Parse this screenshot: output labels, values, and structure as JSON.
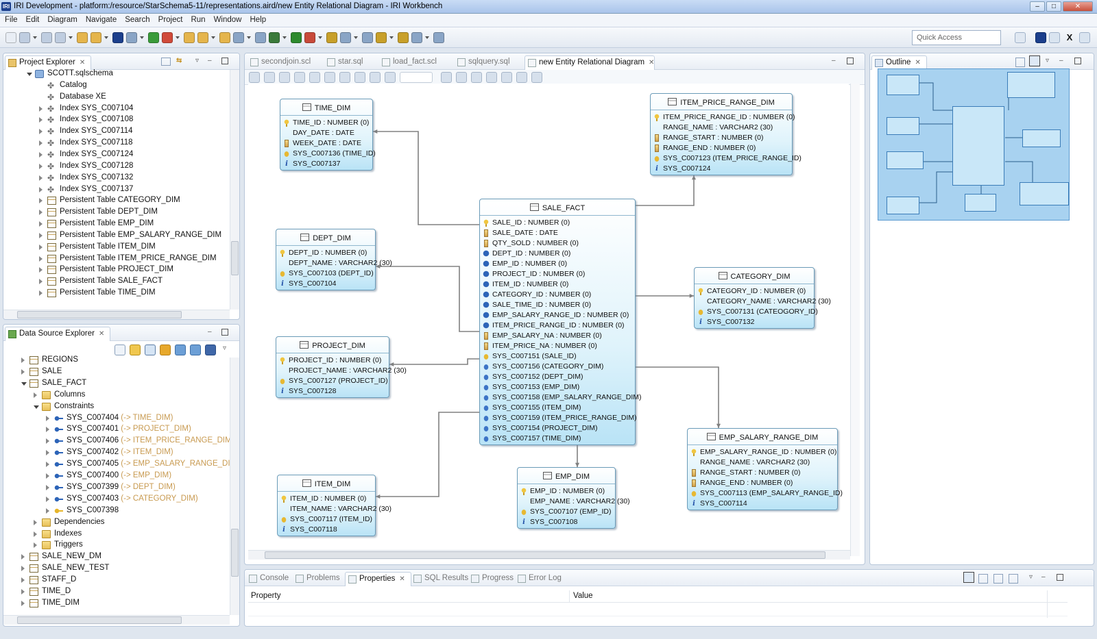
{
  "window": {
    "title": "IRI Development - platform:/resource/StarSchema5-11/representations.aird/new Entity Relational Diagram - IRI Workbench",
    "logo": "IRI",
    "controls": [
      "minimize-icon",
      "restore-icon",
      "close-icon"
    ]
  },
  "menu": [
    "File",
    "Edit",
    "Diagram",
    "Navigate",
    "Search",
    "Project",
    "Run",
    "Window",
    "Help"
  ],
  "quick_access": {
    "placeholder": "Quick Access"
  },
  "project_explorer": {
    "tab": "Project Explorer",
    "items": [
      {
        "label": "SCOTT.sqlschema",
        "level": 0,
        "state": "expanded",
        "icon": "schema-icon"
      },
      {
        "label": "Catalog",
        "level": 1,
        "state": "none",
        "icon": "catalog-icon"
      },
      {
        "label": "Database XE",
        "level": 1,
        "state": "none",
        "icon": "database-icon"
      },
      {
        "label": "Index SYS_C007104",
        "level": 1,
        "state": "collapsed",
        "icon": "index-icon"
      },
      {
        "label": "Index SYS_C007108",
        "level": 1,
        "state": "collapsed",
        "icon": "index-icon"
      },
      {
        "label": "Index SYS_C007114",
        "level": 1,
        "state": "collapsed",
        "icon": "index-icon"
      },
      {
        "label": "Index SYS_C007118",
        "level": 1,
        "state": "collapsed",
        "icon": "index-icon"
      },
      {
        "label": "Index SYS_C007124",
        "level": 1,
        "state": "collapsed",
        "icon": "index-icon"
      },
      {
        "label": "Index SYS_C007128",
        "level": 1,
        "state": "collapsed",
        "icon": "index-icon"
      },
      {
        "label": "Index SYS_C007132",
        "level": 1,
        "state": "collapsed",
        "icon": "index-icon"
      },
      {
        "label": "Index SYS_C007137",
        "level": 1,
        "state": "collapsed",
        "icon": "index-icon"
      },
      {
        "label": "Persistent Table CATEGORY_DIM",
        "level": 1,
        "state": "collapsed",
        "icon": "table-icon"
      },
      {
        "label": "Persistent Table DEPT_DIM",
        "level": 1,
        "state": "collapsed",
        "icon": "table-icon"
      },
      {
        "label": "Persistent Table EMP_DIM",
        "level": 1,
        "state": "collapsed",
        "icon": "table-icon"
      },
      {
        "label": "Persistent Table EMP_SALARY_RANGE_DIM",
        "level": 1,
        "state": "collapsed",
        "icon": "table-icon"
      },
      {
        "label": "Persistent Table ITEM_DIM",
        "level": 1,
        "state": "collapsed",
        "icon": "table-icon"
      },
      {
        "label": "Persistent Table ITEM_PRICE_RANGE_DIM",
        "level": 1,
        "state": "collapsed",
        "icon": "table-icon"
      },
      {
        "label": "Persistent Table PROJECT_DIM",
        "level": 1,
        "state": "collapsed",
        "icon": "table-icon"
      },
      {
        "label": "Persistent Table SALE_FACT",
        "level": 1,
        "state": "collapsed",
        "icon": "table-icon"
      },
      {
        "label": "Persistent Table TIME_DIM",
        "level": 1,
        "state": "collapsed",
        "icon": "table-icon"
      }
    ]
  },
  "data_source_explorer": {
    "tab": "Data Source Explorer",
    "items": [
      {
        "label": "REGIONS",
        "ref": "",
        "level": 0,
        "state": "collapsed",
        "icon": "table-icon"
      },
      {
        "label": "SALE",
        "ref": "",
        "level": 0,
        "state": "collapsed",
        "icon": "table-icon"
      },
      {
        "label": "SALE_FACT",
        "ref": "",
        "level": 0,
        "state": "expanded",
        "icon": "table-icon"
      },
      {
        "label": "Columns",
        "ref": "",
        "level": 1,
        "state": "collapsed",
        "icon": "folder-icon"
      },
      {
        "label": "Constraints",
        "ref": "",
        "level": 1,
        "state": "expanded",
        "icon": "folder-icon"
      },
      {
        "label": "SYS_C007404",
        "ref": "(-> TIME_DIM)",
        "level": 2,
        "state": "collapsed",
        "icon": "foreign-key-icon"
      },
      {
        "label": "SYS_C007401",
        "ref": "(-> PROJECT_DIM)",
        "level": 2,
        "state": "collapsed",
        "icon": "foreign-key-icon"
      },
      {
        "label": "SYS_C007406",
        "ref": "(-> ITEM_PRICE_RANGE_DIM)",
        "level": 2,
        "state": "collapsed",
        "icon": "foreign-key-icon"
      },
      {
        "label": "SYS_C007402",
        "ref": "(-> ITEM_DIM)",
        "level": 2,
        "state": "collapsed",
        "icon": "foreign-key-icon"
      },
      {
        "label": "SYS_C007405",
        "ref": "(-> EMP_SALARY_RANGE_DIM)",
        "level": 2,
        "state": "collapsed",
        "icon": "foreign-key-icon"
      },
      {
        "label": "SYS_C007400",
        "ref": "(-> EMP_DIM)",
        "level": 2,
        "state": "collapsed",
        "icon": "foreign-key-icon"
      },
      {
        "label": "SYS_C007399",
        "ref": "(-> DEPT_DIM)",
        "level": 2,
        "state": "collapsed",
        "icon": "foreign-key-icon"
      },
      {
        "label": "SYS_C007403",
        "ref": "(-> CATEGORY_DIM)",
        "level": 2,
        "state": "collapsed",
        "icon": "foreign-key-icon"
      },
      {
        "label": "SYS_C007398",
        "ref": "",
        "level": 2,
        "state": "collapsed",
        "icon": "primary-key-icon"
      },
      {
        "label": "Dependencies",
        "ref": "",
        "level": 1,
        "state": "collapsed",
        "icon": "folder-icon"
      },
      {
        "label": "Indexes",
        "ref": "",
        "level": 1,
        "state": "collapsed",
        "icon": "folder-icon"
      },
      {
        "label": "Triggers",
        "ref": "",
        "level": 1,
        "state": "collapsed",
        "icon": "folder-icon"
      },
      {
        "label": "SALE_NEW_DM",
        "ref": "",
        "level": 0,
        "state": "collapsed",
        "icon": "table-icon"
      },
      {
        "label": "SALE_NEW_TEST",
        "ref": "",
        "level": 0,
        "state": "collapsed",
        "icon": "table-icon"
      },
      {
        "label": "STAFF_D",
        "ref": "",
        "level": 0,
        "state": "collapsed",
        "icon": "table-icon"
      },
      {
        "label": "TIME_D",
        "ref": "",
        "level": 0,
        "state": "collapsed",
        "icon": "table-icon"
      },
      {
        "label": "TIME_DIM",
        "ref": "",
        "level": 0,
        "state": "collapsed",
        "icon": "table-icon"
      }
    ]
  },
  "editor": {
    "tabs": [
      {
        "label": "secondjoin.scl",
        "active": false
      },
      {
        "label": "star.sql",
        "active": false
      },
      {
        "label": "load_fact.scl",
        "active": false
      },
      {
        "label": "sqlquery.sql",
        "active": false
      },
      {
        "label": "new Entity Relational Diagram",
        "active": true
      }
    ]
  },
  "diagram": {
    "entities": [
      {
        "name": "TIME_DIM",
        "rows": [
          {
            "icon": "key",
            "text": "TIME_ID : NUMBER (0)"
          },
          {
            "icon": "none",
            "text": "DAY_DATE : DATE"
          },
          {
            "icon": "col",
            "text": "WEEK_DATE : DATE"
          },
          {
            "icon": "ucon",
            "text": "SYS_C007136 (TIME_ID)"
          },
          {
            "icon": "info",
            "text": "SYS_C007137"
          }
        ]
      },
      {
        "name": "ITEM_PRICE_RANGE_DIM",
        "rows": [
          {
            "icon": "key",
            "text": "ITEM_PRICE_RANGE_ID : NUMBER (0)"
          },
          {
            "icon": "none",
            "text": "RANGE_NAME : VARCHAR2 (30)"
          },
          {
            "icon": "col",
            "text": "RANGE_START : NUMBER (0)"
          },
          {
            "icon": "col",
            "text": "RANGE_END : NUMBER (0)"
          },
          {
            "icon": "ucon",
            "text": "SYS_C007123 (ITEM_PRICE_RANGE_ID)"
          },
          {
            "icon": "info",
            "text": "SYS_C007124"
          }
        ]
      },
      {
        "name": "DEPT_DIM",
        "rows": [
          {
            "icon": "key",
            "text": "DEPT_ID : NUMBER (0)"
          },
          {
            "icon": "none",
            "text": "DEPT_NAME : VARCHAR2 (30)"
          },
          {
            "icon": "ucon",
            "text": "SYS_C007103 (DEPT_ID)"
          },
          {
            "icon": "info",
            "text": "SYS_C007104"
          }
        ]
      },
      {
        "name": "SALE_FACT",
        "rows": [
          {
            "icon": "key",
            "text": "SALE_ID : NUMBER (0)"
          },
          {
            "icon": "col",
            "text": "SALE_DATE : DATE"
          },
          {
            "icon": "col",
            "text": "QTY_SOLD : NUMBER (0)"
          },
          {
            "icon": "fk",
            "text": "DEPT_ID : NUMBER (0)"
          },
          {
            "icon": "fk",
            "text": "EMP_ID : NUMBER (0)"
          },
          {
            "icon": "fk",
            "text": "PROJECT_ID : NUMBER (0)"
          },
          {
            "icon": "fk",
            "text": "ITEM_ID : NUMBER (0)"
          },
          {
            "icon": "fk",
            "text": "CATEGORY_ID : NUMBER (0)"
          },
          {
            "icon": "fk",
            "text": "SALE_TIME_ID : NUMBER (0)"
          },
          {
            "icon": "fk",
            "text": "EMP_SALARY_RANGE_ID : NUMBER (0)"
          },
          {
            "icon": "fk",
            "text": "ITEM_PRICE_RANGE_ID : NUMBER (0)"
          },
          {
            "icon": "col",
            "text": "EMP_SALARY_NA : NUMBER (0)"
          },
          {
            "icon": "col",
            "text": "ITEM_PRICE_NA : NUMBER (0)"
          },
          {
            "icon": "ucon",
            "text": "SYS_C007151 (SALE_ID)"
          },
          {
            "icon": "fkcon",
            "text": "SYS_C007156 (CATEGORY_DIM)"
          },
          {
            "icon": "fkcon",
            "text": "SYS_C007152 (DEPT_DIM)"
          },
          {
            "icon": "fkcon",
            "text": "SYS_C007153 (EMP_DIM)"
          },
          {
            "icon": "fkcon",
            "text": "SYS_C007158 (EMP_SALARY_RANGE_DIM)"
          },
          {
            "icon": "fkcon",
            "text": "SYS_C007155 (ITEM_DIM)"
          },
          {
            "icon": "fkcon",
            "text": "SYS_C007159 (ITEM_PRICE_RANGE_DIM)"
          },
          {
            "icon": "fkcon",
            "text": "SYS_C007154 (PROJECT_DIM)"
          },
          {
            "icon": "fkcon",
            "text": "SYS_C007157 (TIME_DIM)"
          }
        ]
      },
      {
        "name": "CATEGORY_DIM",
        "rows": [
          {
            "icon": "key",
            "text": "CATEGORY_ID : NUMBER (0)"
          },
          {
            "icon": "none",
            "text": "CATEGORY_NAME : VARCHAR2 (30)"
          },
          {
            "icon": "ucon",
            "text": "SYS_C007131 (CATEOGORY_ID)"
          },
          {
            "icon": "info",
            "text": "SYS_C007132"
          }
        ]
      },
      {
        "name": "PROJECT_DIM",
        "rows": [
          {
            "icon": "key",
            "text": "PROJECT_ID : NUMBER (0)"
          },
          {
            "icon": "none",
            "text": "PROJECT_NAME : VARCHAR2 (30)"
          },
          {
            "icon": "ucon",
            "text": "SYS_C007127 (PROJECT_ID)"
          },
          {
            "icon": "info",
            "text": "SYS_C007128"
          }
        ]
      },
      {
        "name": "EMP_SALARY_RANGE_DIM",
        "rows": [
          {
            "icon": "key",
            "text": "EMP_SALARY_RANGE_ID : NUMBER (0)"
          },
          {
            "icon": "none",
            "text": "RANGE_NAME : VARCHAR2 (30)"
          },
          {
            "icon": "col",
            "text": "RANGE_START : NUMBER (0)"
          },
          {
            "icon": "col",
            "text": "RANGE_END : NUMBER (0)"
          },
          {
            "icon": "ucon",
            "text": "SYS_C007113 (EMP_SALARY_RANGE_ID)"
          },
          {
            "icon": "info",
            "text": "SYS_C007114"
          }
        ]
      },
      {
        "name": "ITEM_DIM",
        "rows": [
          {
            "icon": "key",
            "text": "ITEM_ID : NUMBER (0)"
          },
          {
            "icon": "none",
            "text": "ITEM_NAME : VARCHAR2 (30)"
          },
          {
            "icon": "ucon",
            "text": "SYS_C007117 (ITEM_ID)"
          },
          {
            "icon": "info",
            "text": "SYS_C007118"
          }
        ]
      },
      {
        "name": "EMP_DIM",
        "rows": [
          {
            "icon": "key",
            "text": "EMP_ID : NUMBER (0)"
          },
          {
            "icon": "none",
            "text": "EMP_NAME : VARCHAR2 (30)"
          },
          {
            "icon": "ucon",
            "text": "SYS_C007107 (EMP_ID)"
          },
          {
            "icon": "info",
            "text": "SYS_C007108"
          }
        ]
      }
    ]
  },
  "outline": {
    "tab": "Outline"
  },
  "bottom_panel": {
    "tabs": [
      {
        "label": "Console",
        "active": false
      },
      {
        "label": "Problems",
        "active": false
      },
      {
        "label": "Properties",
        "active": true
      },
      {
        "label": "SQL Results",
        "active": false
      },
      {
        "label": "Progress",
        "active": false
      },
      {
        "label": "Error Log",
        "active": false
      }
    ],
    "columns": [
      "Property",
      "Value"
    ]
  },
  "colors": {
    "entity_border": "#6a9bb8",
    "connector": "#808080",
    "outline_bg": "#a8d2f0",
    "reference_text": "#c89a50"
  }
}
